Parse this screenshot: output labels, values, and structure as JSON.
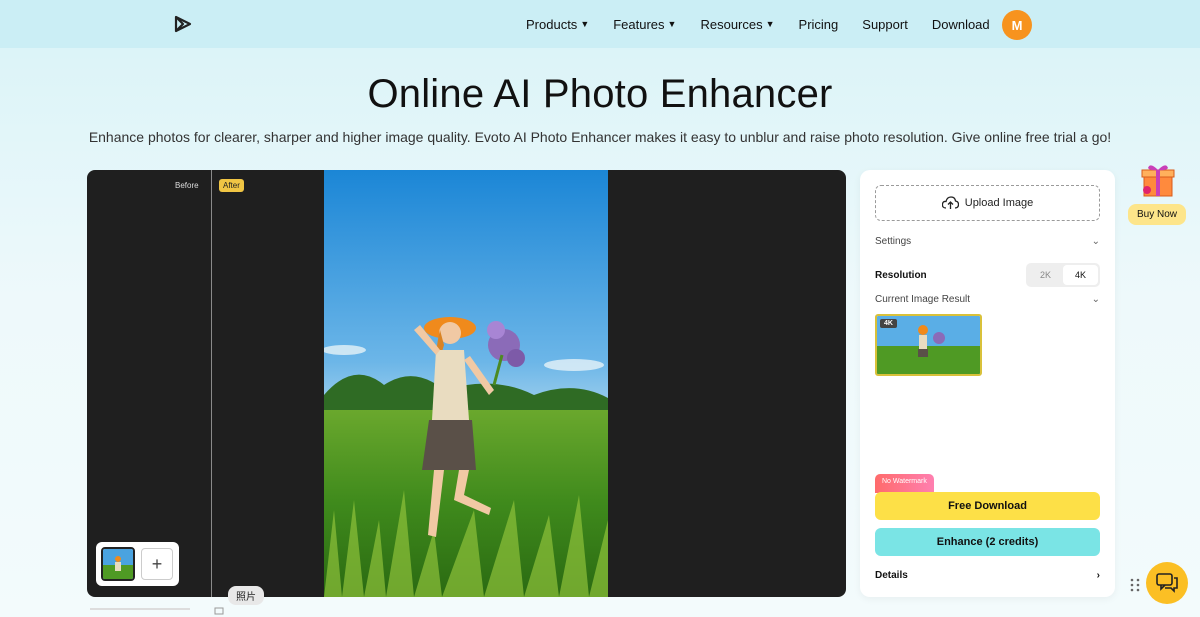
{
  "nav": {
    "items": [
      {
        "label": "Products",
        "dropdown": true
      },
      {
        "label": "Features",
        "dropdown": true
      },
      {
        "label": "Resources",
        "dropdown": true
      },
      {
        "label": "Pricing",
        "dropdown": false
      },
      {
        "label": "Support",
        "dropdown": false
      },
      {
        "label": "Download",
        "dropdown": false
      }
    ],
    "avatar_initial": "M",
    "caret": "▼"
  },
  "hero": {
    "title": "Online AI Photo Enhancer",
    "subtitle": "Enhance photos for clearer, sharper and higher image quality. Evoto AI Photo Enhancer makes it easy to unblur and raise photo resolution. Give online free trial a go!"
  },
  "editor": {
    "before_label": "Before",
    "after_label": "After",
    "add_symbol": "+",
    "tooltip": "照片"
  },
  "panel": {
    "upload_label": "Upload Image",
    "settings_label": "Settings",
    "resolution_label": "Resolution",
    "resolution_options": [
      "2K",
      "4K"
    ],
    "resolution_selected": "4K",
    "current_result_label": "Current Image Result",
    "result_badge": "4K",
    "no_watermark": "No Watermark",
    "free_download": "Free Download",
    "enhance": "Enhance (2 credits)",
    "details": "Details",
    "chevron_down": "⌄",
    "chevron_right": "›"
  },
  "side": {
    "buy_now": "Buy Now"
  },
  "colors": {
    "avatar": "#f7931e",
    "free_download": "#fde047",
    "enhance": "#7ae4e5",
    "after_badge": "#f0c544",
    "chat": "#fbbf24"
  }
}
